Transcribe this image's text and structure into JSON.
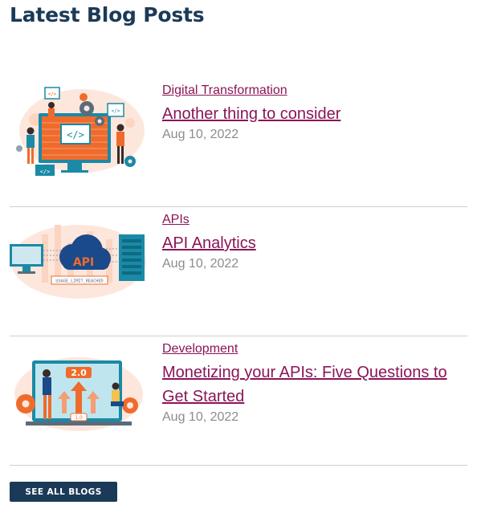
{
  "heading": "Latest Blog Posts",
  "posts": [
    {
      "category": "Digital Transformation",
      "title": "Another thing to consider",
      "date": "Aug 10, 2022",
      "image": "developers-coding-illustration"
    },
    {
      "category": "APIs",
      "title": "API Analytics",
      "date": "Aug 10, 2022",
      "image": "api-cloud-server-illustration",
      "image_text": [
        "API",
        "USAGE_LIMIT_REACHED"
      ]
    },
    {
      "category": "Development",
      "title": "Monetizing your APIs: Five Questions to Get Started",
      "date": "Aug 10, 2022",
      "image": "api-version-upgrade-illustration",
      "image_text": [
        "2.0",
        "1.0"
      ]
    }
  ],
  "see_all_label": "SEE ALL BLOGS",
  "colors": {
    "heading": "#1b3a57",
    "link": "#8a1556",
    "date": "#8c8c8c",
    "divider": "#cfcfcf",
    "button_bg": "#1b3a57",
    "accent_orange": "#ef6b2c",
    "accent_teal": "#1a8aa6"
  }
}
